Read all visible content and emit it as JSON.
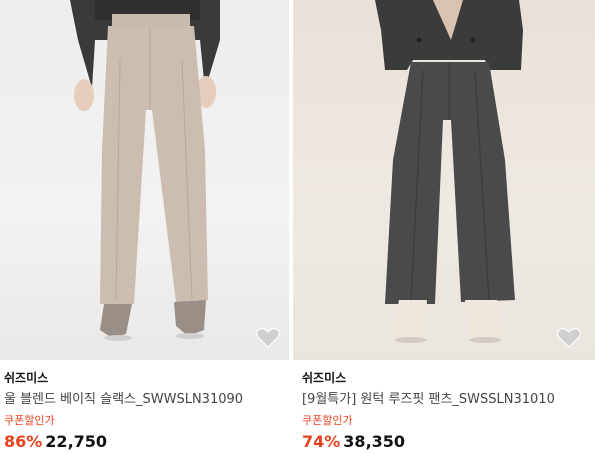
{
  "products": [
    {
      "brand": "쉬즈미스",
      "name": "울 블렌드 베이직 슬랙스_SWWSLN31090",
      "coupon_label": "쿠폰할인가",
      "discount_rate": "86%",
      "price": "22,750",
      "image_icon": "beige-slacks-photo",
      "wish_icon": "heart-icon"
    },
    {
      "brand": "쉬즈미스",
      "name": "[9월특가] 원턱 루즈핏 팬츠_SWSSLN31010",
      "coupon_label": "쿠폰할인가",
      "discount_rate": "74%",
      "price": "38,350",
      "image_icon": "charcoal-wide-pants-photo",
      "wish_icon": "heart-icon"
    }
  ],
  "colors": {
    "accent": "#e8421f",
    "text": "#111111",
    "beige_pants": "#c9bcae",
    "charcoal_pants": "#4b4b4b"
  }
}
